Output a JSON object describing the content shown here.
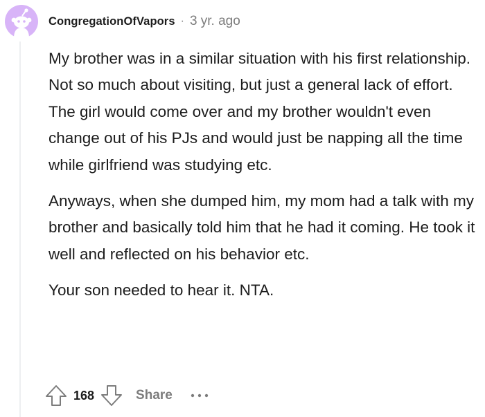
{
  "comment": {
    "author": "CongregationOfVapors",
    "separator": "·",
    "timestamp": "3 yr. ago",
    "paragraphs": [
      "My brother was in a similar situation with his first relationship. Not so much about visiting, but just a general lack of effort. The girl would come over and my brother wouldn't even change out of his PJs and would just be napping all the time while girlfriend was studying etc.",
      "Anyways, when she dumped him, my mom had a talk with my brother and basically told him that he had it coming. He took it well and reflected on his behavior etc.",
      "Your son needed to hear it. NTA."
    ]
  },
  "actions": {
    "upvote_icon": "upvote-arrow-icon",
    "score": "168",
    "downvote_icon": "downvote-arrow-icon",
    "share_label": "Share",
    "more_icon": "more-options-icon"
  },
  "colors": {
    "avatar_bg": "#d8b4f8",
    "avatar_figure": "#ffffff",
    "meta_gray": "#7c7c7c",
    "text": "#1c1c1c",
    "thread_line": "#edeff1"
  }
}
